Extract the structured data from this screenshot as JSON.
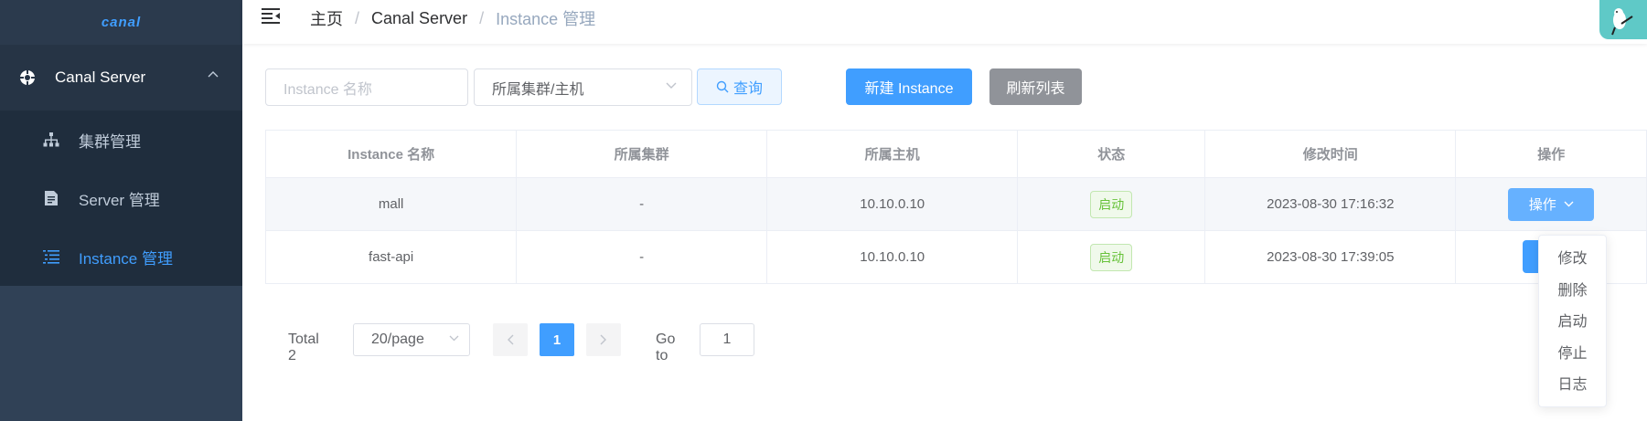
{
  "app": {
    "logo_text": "canal"
  },
  "sidebar": {
    "group": {
      "label": "Canal Server",
      "icon": "canal-server-icon",
      "expanded": true
    },
    "items": [
      {
        "label": "集群管理",
        "icon": "cluster-tree-icon",
        "active": false
      },
      {
        "label": "Server 管理",
        "icon": "server-doc-icon",
        "active": false
      },
      {
        "label": "Instance 管理",
        "icon": "list-icon",
        "active": true
      }
    ]
  },
  "navbar": {
    "breadcrumb": [
      "主页",
      "Canal Server",
      "Instance 管理"
    ],
    "separator": "/"
  },
  "filters": {
    "name_placeholder": "Instance 名称",
    "cluster_select": "所属集群/主机",
    "query_label": "查询",
    "create_label": "新建 Instance",
    "refresh_label": "刷新列表"
  },
  "table": {
    "columns": [
      "Instance 名称",
      "所属集群",
      "所属主机",
      "状态",
      "修改时间",
      "操作"
    ],
    "rows": [
      {
        "name": "mall",
        "cluster": "-",
        "host": "10.10.0.10",
        "status": "启动",
        "modified": "2023-08-30 17:16:32",
        "action": "操作"
      },
      {
        "name": "fast-api",
        "cluster": "-",
        "host": "10.10.0.10",
        "status": "启动",
        "modified": "2023-08-30 17:39:05",
        "action": ""
      }
    ]
  },
  "pagination": {
    "total": "Total 2",
    "page_size": "20/page",
    "current_page": "1",
    "goto_label": "Go to",
    "goto_value": "1"
  },
  "dropdown_menu": [
    "修改",
    "删除",
    "启动",
    "停止",
    "日志"
  ],
  "colors": {
    "primary": "#409eff",
    "sidebar_bg": "#304156",
    "success": "#67c23a",
    "info": "#909399"
  }
}
